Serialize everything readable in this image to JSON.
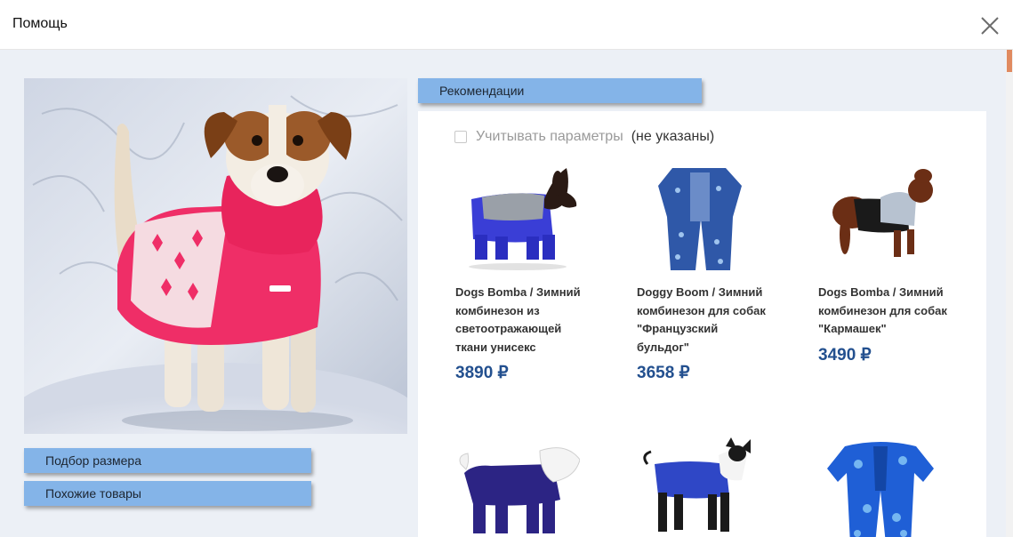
{
  "window": {
    "title": "Помощь",
    "close_icon": "close-icon"
  },
  "left": {
    "photo_alt": "Собака в вязаном свитере",
    "size_button": "Подбор размера",
    "similar_button": "Похожие товары"
  },
  "recommendations": {
    "tab_label": "Рекомендации",
    "filter_label": "Учитывать параметры",
    "filter_note": "(не указаны)",
    "filter_checked": false,
    "products": [
      {
        "name": "Dogs Bomba / Зимний комбинезон из светоотражающей ткани унисекс",
        "price": "3890 ₽"
      },
      {
        "name": "Doggy Boom / Зимний комбинезон для собак \"Французский бульдог\"",
        "price": "3658 ₽"
      },
      {
        "name": "Dogs Bomba / Зимний комбинезон для собак \"Кармашек\"",
        "price": "3490 ₽"
      },
      {
        "name": "",
        "price": ""
      },
      {
        "name": "",
        "price": ""
      },
      {
        "name": "",
        "price": ""
      }
    ]
  },
  "colors": {
    "button_bg": "#84b4e8",
    "content_bg": "#ecf0f6",
    "price": "#23508f",
    "scroll_thumb": "#e08a60"
  }
}
